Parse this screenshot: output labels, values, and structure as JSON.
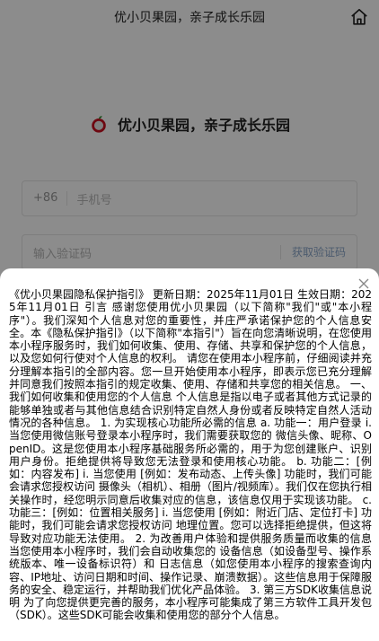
{
  "header": {
    "title": "优小贝果园，亲子成长乐园",
    "home_icon": "home-icon"
  },
  "login": {
    "brand_name": "优小贝果园，亲子成长乐园",
    "logo_icon": "apple-logo-icon",
    "country_code": "+86",
    "phone_placeholder": "手机号",
    "code_placeholder": "输入验证码",
    "get_code_label": "获取验证码"
  },
  "privacy_sheet": {
    "close_icon": "close-icon",
    "text": "《优小贝果园隐私保护指引》 更新日期：2025年11月01日 生效日期：2025年11月01日 引言 感谢您使用优小贝果园（以下简称\"我们\"或\"本小程序\"）。我们深知个人信息对您的重要性，并庄严承诺保护您的个人信息安全。本《隐私保护指引》（以下简称\"本指引\"）旨在向您清晰说明，在您使用本小程序服务时，我们如何收集、使用、存储、共享和保护您的个人信息，以及您如何行使对个人信息的权利。 请您在使用本小程序前，仔细阅读并充分理解本指引的全部内容。您一旦开始使用本小程序，即表示您已充分理解并同意我们按照本指引的规定收集、使用、存储和共享您的相关信息。 一、我们如何收集和使用您的个人信息 个人信息是指以电子或者其他方式记录的能够单独或者与其他信息结合识别特定自然人身份或者反映特定自然人活动情况的各种信息。 1. 为实现核心功能所必需的信息 a. 功能一：用户登录 i. 当您使用微信账号登录本小程序时，我们需要获取您的 微信头像、昵称、OpenID。这是您使用本小程序基础服务所必需的，用于为您创建账户、识别用户身份。拒绝提供将导致您无法登录和使用核心功能。 b. 功能二：[例如：内容发布] i. 当您使用 [例如：发布动态、上传头像] 功能时，我们可能会请求您授权访问 摄像头（相机）、相册（图片/视频库）。我们仅在您执行相关操作时，经您明示同意后收集对应的信息，该信息仅用于实现该功能。 c. 功能三：[例如：位置相关服务] i. 当您使用 [例如：附近门店、定位打卡] 功能时，我们可能会请求您授权访问 地理位置。您可以选择拒绝提供，但这将导致对应功能无法使用。 2. 为改善用户体验和提供服务质量而收集的信息 当您使用本小程序时，我们会自动收集您的 设备信息（如设备型号、操作系统版本、唯一设备标识符）和 日志信息（如您使用本小程序的搜索查询内容、IP地址、访问日期和时间、操作记录、崩溃数据）。这些信息用于保障服务的安全、稳定运行，并帮助我们优化产品体验。 3. 第三方SDK收集信息说明 为了向您提供更完善的服务，本小程序可能集成了第三方软件工具开发包（SDK）。这些SDK可能会收集和使用您的部分个人信息。"
  }
}
